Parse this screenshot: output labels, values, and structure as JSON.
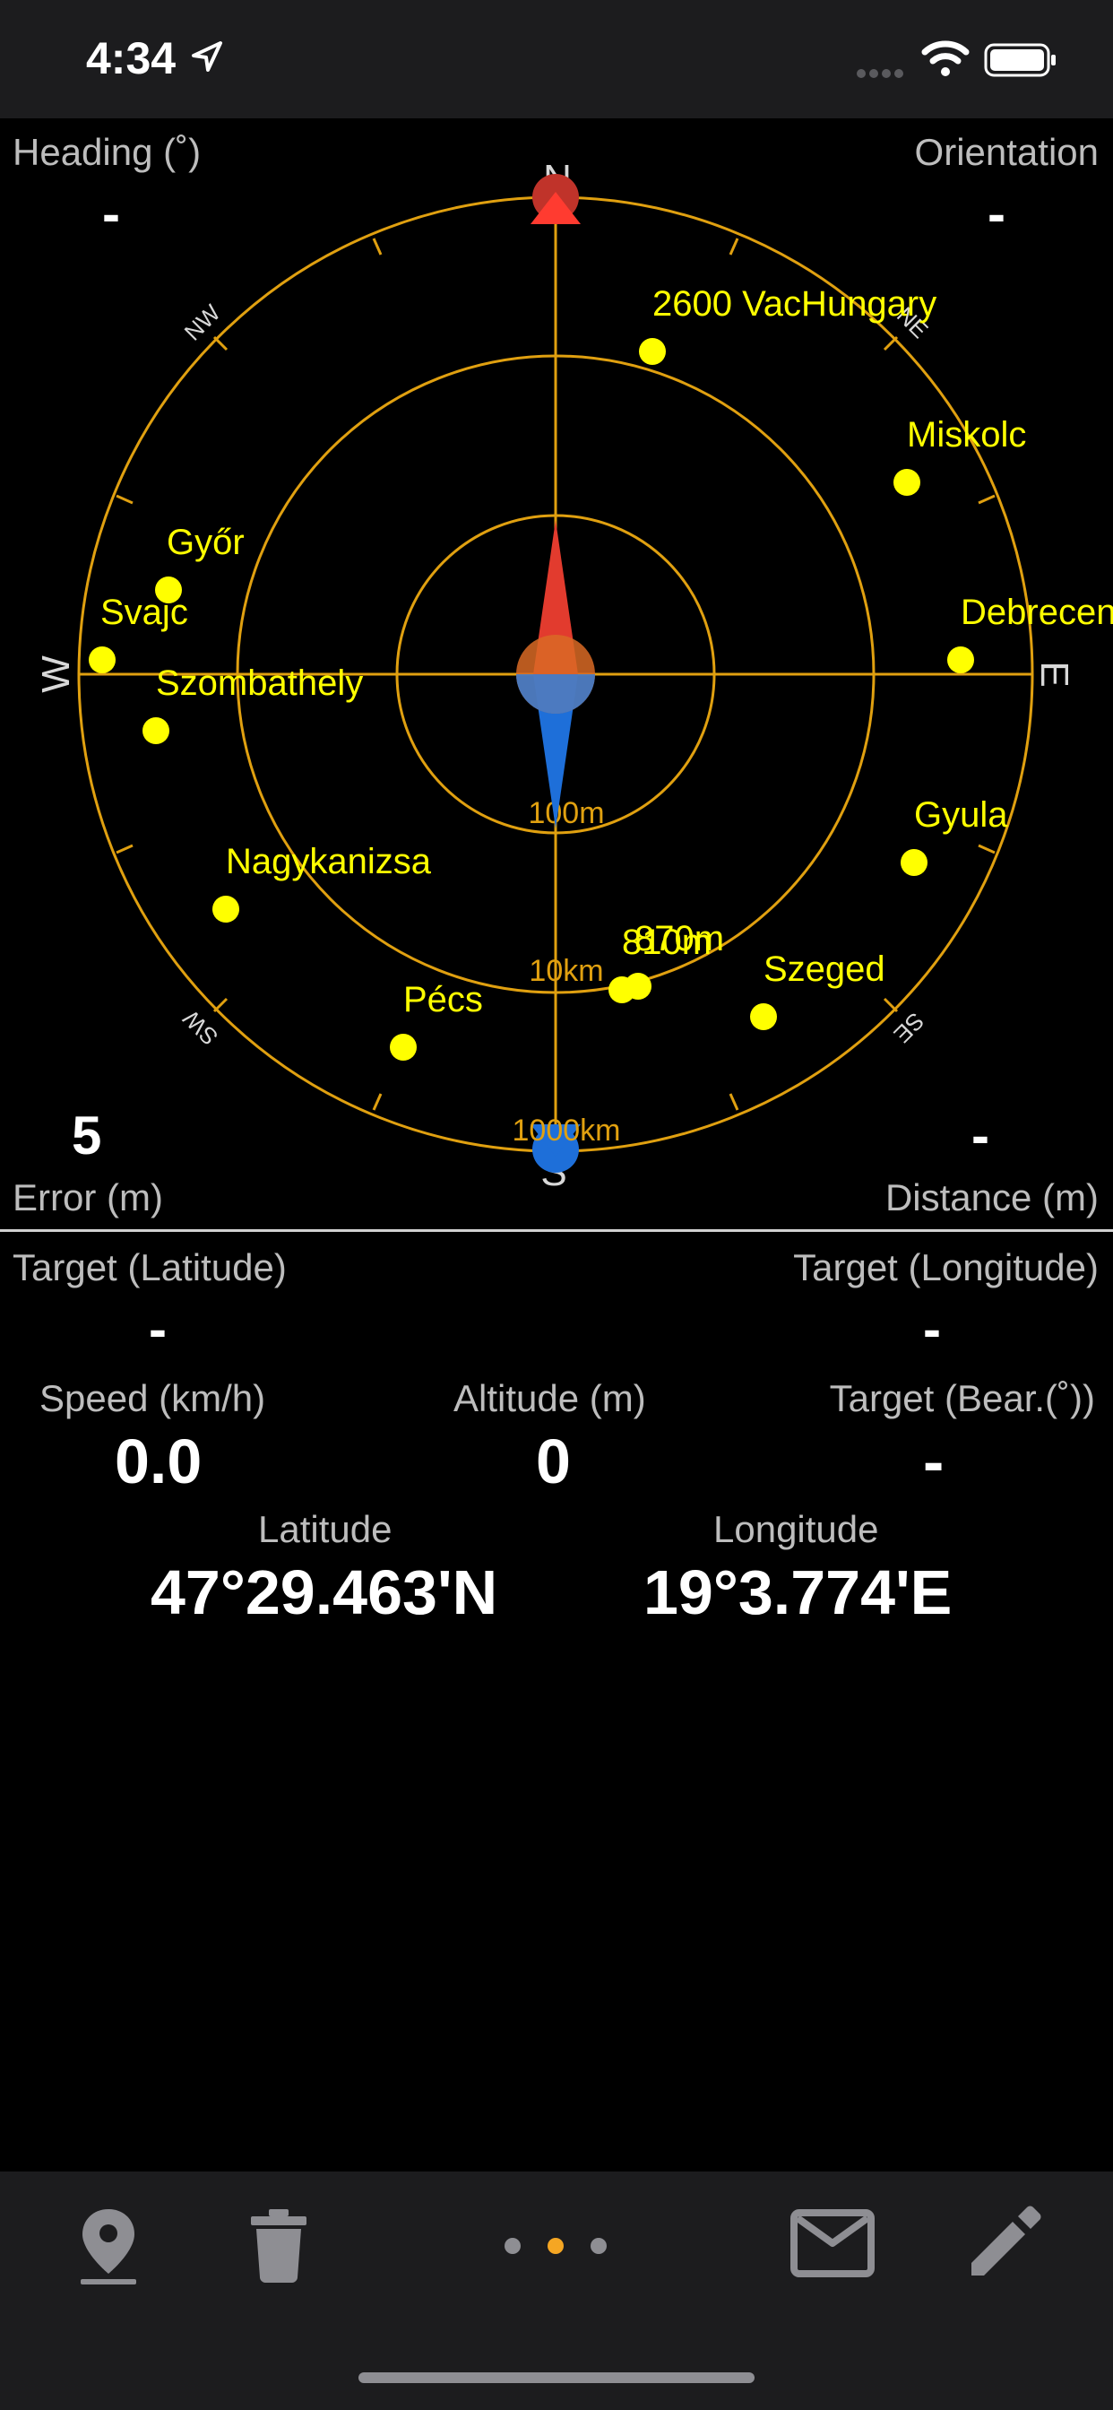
{
  "status_bar": {
    "time": "4:34"
  },
  "compass": {
    "heading_label": "Heading (˚)",
    "heading_value": "-",
    "orientation_label": "Orientation",
    "orientation_value": "-",
    "error_value": "5",
    "error_label": "Error (m)",
    "distance_value": "-",
    "distance_label": "Distance (m)",
    "cardinal": {
      "n": "N",
      "s": "S",
      "e": "E",
      "w": "W",
      "ne": "NE",
      "nw": "NW",
      "se": "SE",
      "sw": "SW"
    },
    "ring_labels": [
      "100m",
      "10km",
      "1000km"
    ],
    "places": [
      {
        "name": "2600 VacHungary"
      },
      {
        "name": "Miskolc"
      },
      {
        "name": "Győr"
      },
      {
        "name": "Svajc"
      },
      {
        "name": "Debrecen"
      },
      {
        "name": "Szombathely"
      },
      {
        "name": "Gyula"
      },
      {
        "name": "Nagykanizsa"
      },
      {
        "name": "870m"
      },
      {
        "name": "810m"
      },
      {
        "name": "Szeged"
      },
      {
        "name": "Pécs"
      }
    ],
    "colors": {
      "ring": "#e0a010",
      "marker": "#ffff00",
      "needle_north": "#e23b2e",
      "needle_south": "#1e6fd9"
    }
  },
  "info": {
    "target_lat_label": "Target (Latitude)",
    "target_lat_value": "-",
    "target_lon_label": "Target (Longitude)",
    "target_lon_value": "-",
    "speed_label": "Speed (km/h)",
    "speed_value": "0.0",
    "altitude_label": "Altitude (m)",
    "altitude_value": "0",
    "bearing_label": "Target (Bear.(˚))",
    "bearing_value": "-",
    "latitude_label": "Latitude",
    "latitude_value": "47°29.463'N",
    "longitude_label": "Longitude",
    "longitude_value": "19°3.774'E"
  },
  "tab_bar": {
    "icons": [
      "map-pin-icon",
      "trash-icon",
      "page-dots",
      "mail-icon",
      "pencil-icon"
    ],
    "active_page_index": 1,
    "page_count": 3,
    "active_color": "#f5a623"
  }
}
